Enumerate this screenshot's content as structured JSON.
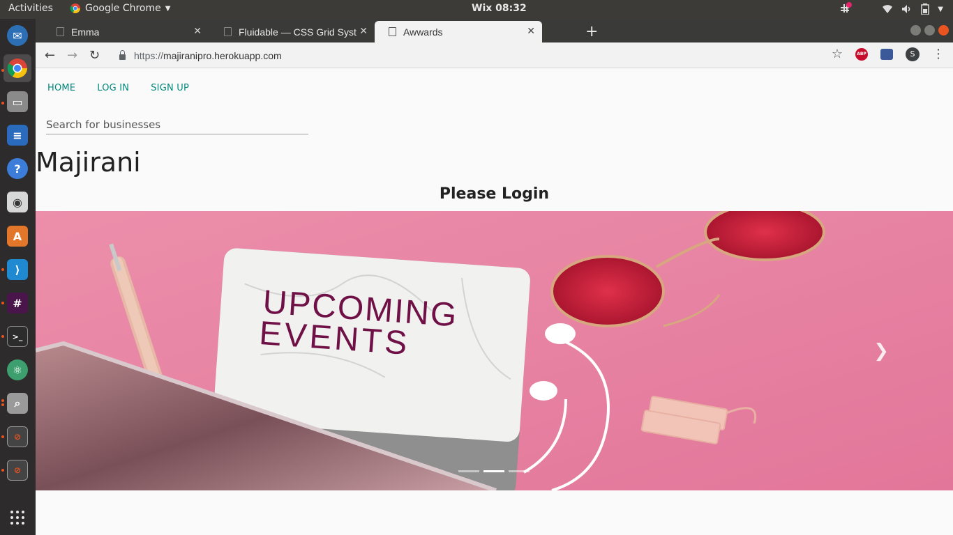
{
  "topbar": {
    "activities": "Activities",
    "app_name": "Google Chrome",
    "clock": "Wix 08:32"
  },
  "dock": {
    "items": [
      {
        "name": "thunderbird-icon",
        "color": "#2d6fb5"
      },
      {
        "name": "chrome-icon",
        "color": "#db4437"
      },
      {
        "name": "files-icon",
        "color": "#7a7a7a"
      },
      {
        "name": "libreoffice-writer-icon",
        "color": "#2a6bbd"
      },
      {
        "name": "help-icon",
        "color": "#3b7dd8"
      },
      {
        "name": "rhythmbox-icon",
        "color": "#d7d7d7"
      },
      {
        "name": "software-center-icon",
        "color": "#e2762b"
      },
      {
        "name": "vscode-icon",
        "color": "#1f8ad2"
      },
      {
        "name": "slack-icon",
        "color": "#4a154b"
      },
      {
        "name": "terminal-icon",
        "color": "#2c2c2c"
      },
      {
        "name": "atom-icon",
        "color": "#3e9f6e"
      },
      {
        "name": "image-viewer-icon",
        "color": "#9a9a9a"
      },
      {
        "name": "window-icon",
        "color": "#444"
      },
      {
        "name": "window-icon-2",
        "color": "#444"
      },
      {
        "name": "app-grid-icon",
        "color": "#2d2b2c"
      }
    ]
  },
  "tabs": [
    {
      "title": "Emma"
    },
    {
      "title": "Fluidable — CSS Grid Syst"
    },
    {
      "title": "Awwards"
    }
  ],
  "toolbar": {
    "url_scheme": "https://",
    "url_host": "majiranipro.herokuapp.com",
    "avatar_letter": "S",
    "abp_label": "ABP"
  },
  "page": {
    "nav": {
      "home": "HOME",
      "login": "LOG IN",
      "signup": "SIGN UP"
    },
    "search_placeholder": "Search for businesses",
    "brand": "Majirani",
    "please_login": "Please Login"
  },
  "carousel": {
    "image_text_line1": "UPCOMING",
    "image_text_line2": "EVENTS",
    "slide_count": 3,
    "active_slide": 2
  },
  "colors": {
    "accent": "#00897b",
    "ubuntu_orange": "#e95420",
    "carousel_bg": "#ea8aa6"
  }
}
